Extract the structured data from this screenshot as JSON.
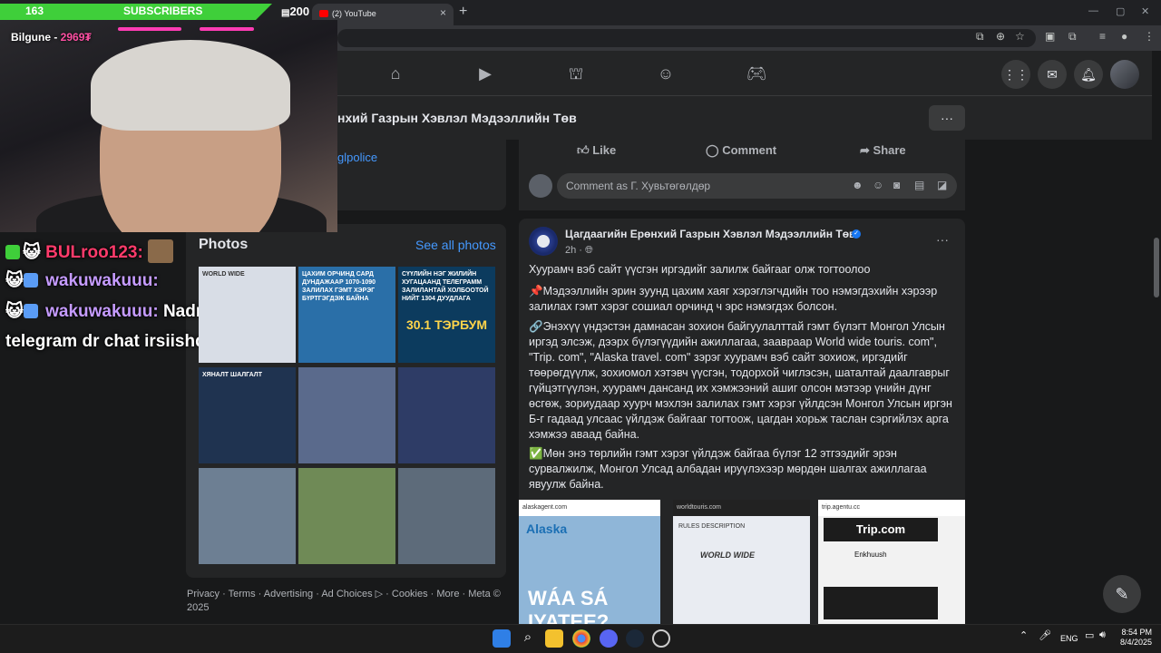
{
  "stream": {
    "subscriber_count": "163",
    "subscriber_label": "SUBSCRIBERS",
    "subscriber_goal": "200",
    "streamer_label": "Bilgune -",
    "streamer_points": "2969₮",
    "chat": [
      {
        "user": "BULroo123:",
        "message": ""
      },
      {
        "user": "wakuwakuuu:",
        "message": ""
      },
      {
        "user": "wakuwakuuu:",
        "message": "Nadru"
      },
      {
        "user": "",
        "message": "telegram dr chat irsiishd"
      }
    ]
  },
  "browser": {
    "tab_title": "(2) YouTube",
    "new_tab": "+",
    "close_tab": "×"
  },
  "facebook": {
    "page_title": "нхий Газрын Хэвлэл Мэдээллийн Төв",
    "intro_link": "glpolice",
    "more_button": "···",
    "photos": {
      "title": "Photos",
      "see_all": "See all photos",
      "tiles": [
        {
          "caption": "WORLD WIDE",
          "big": "",
          "bg": "#d8dde6"
        },
        {
          "caption": "ЦАХИМ ОРЧИНД САРД ДУНДАЖААР 1070-1090 ЗАЛИЛАХ ГЭМТ ХЭРЭГ БҮРТГЭГДЭЖ БАЙНА",
          "big": "",
          "bg": "#2a6fa8"
        },
        {
          "caption": "СҮҮЛИЙН НЭГ ЖИЛИЙН ХУГАЦААНД ТЕЛЕГРАММ ЗАЛИЛАНТАЙ ХОЛБООТОЙ НИЙТ 1304 ДУУДЛАГА",
          "big": "30.1 ТЭРБУМ",
          "bg": "#0c3b5e"
        },
        {
          "caption": "ХЯНАЛТ ШАЛГАЛТ",
          "big": "",
          "bg": "#1f3350"
        },
        {
          "caption": "",
          "big": "",
          "bg": "#5a6a8c"
        },
        {
          "caption": "",
          "big": "",
          "bg": "#2e3c66"
        },
        {
          "caption": "",
          "big": "",
          "bg": "#6d7f93"
        },
        {
          "caption": "",
          "big": "",
          "bg": "#6f8a56"
        },
        {
          "caption": "",
          "big": "",
          "bg": "#5d6b7a"
        }
      ]
    },
    "footer": "Privacy · Terms · Advertising · Ad Choices ▷ · Cookies · More · Meta © 2025",
    "post_actions": {
      "like": "Like",
      "comment": "Comment",
      "share": "Share"
    },
    "comment_placeholder": "Comment as Г. Хувьтөгөлдөр",
    "post": {
      "author": "Цагдаагийн Ерөнхий Газрын Хэвлэл Мэдээллийн Төв",
      "time": "2h ·",
      "more": "···",
      "paragraphs": [
        "Хуурамч вэб сайт үүсгэн иргэдийг залилж байгааг олж тогтоолоо",
        "📌Мэдээллийн эрин зуунд цахим хаяг хэрэглэгчдийн тоо нэмэгдэхийн хэрээр залилах гэмт хэрэг сошиал орчинд ч эрс нэмэгдэх болсон.",
        "🔗Энэхүү үндэстэн дамнасан зохион байгуулалттай гэмт бүлэгт Монгол Улсын иргэд элсэж, дээрх бүлэгүүдийн ажиллагаа, заавраар World wide touris. com\", \"Trip. com\", \"Alaska travel. com\" зэрэг хуурамч вэб сайт зохиож, иргэдийг төөрөгдүүлж, зохиомол хэтэвч үүсгэн, тодорхой чиглэсэн, шаталтай даалгаврыг гүйцэтгүүлэн, хуурамч дансанд их хэмжээний ашиг олсон мэтээр үнийн дүнг өсгөж, зориудаар хуурч мэхлэн залилах гэмт хэрэг үйлдсэн Монгол Улсын иргэн Б-г гадаад улсаас үйлдэж байгааг тогтоож, цагдан хорьж таслан сэргийлэх арга хэмжээ аваад байна.",
        "✅Мөн энэ төрлийн гэмт хэрэг үйлдэж байгаа бүлэг 12 этгээдийг эрэн сурвалжилж, Монгол Улсад албадан ируүлэхээр мөрдөн шалгах ажиллагаа явуулж байна."
      ],
      "images": [
        {
          "url": "alaskagent.com",
          "label": "Alaska",
          "overlay": "WÁA SÁ IYATEE?",
          "bg": "#8fb6d8"
        },
        {
          "url": "worldtouris.com",
          "label": "RULES DESCRIPTION",
          "overlay": "WORLD WIDE",
          "bg": "#e9ecf2"
        },
        {
          "url": "trip.agentu.cc",
          "label": "Trip.com",
          "overlay": "Enkhuush",
          "bg": "#f2f2f2"
        }
      ]
    }
  },
  "taskbar": {
    "lang": "ENG",
    "time": "8:54 PM",
    "date": "8/4/2025"
  },
  "colors": {
    "accent_blue": "#4599ff",
    "verified": "#1877f2",
    "sub_green": "#3fcf3a"
  }
}
